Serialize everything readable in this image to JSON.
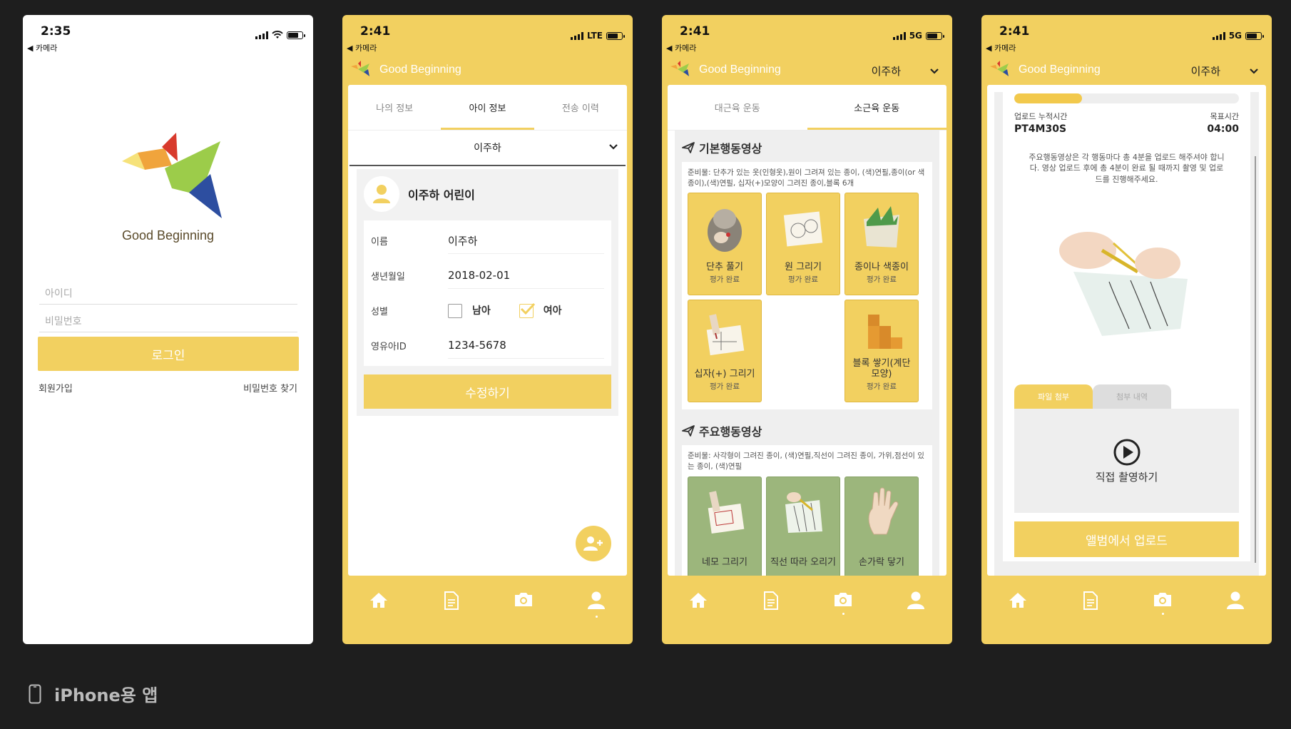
{
  "colors": {
    "accent": "#f2d060",
    "background": "#1e1e1e",
    "white": "#ffffff"
  },
  "status": {
    "back_label": "◀ 카메라",
    "p1_time": "2:35",
    "p2_time": "2:41",
    "p2_net": "LTE",
    "p3_time": "2:41",
    "p3_net": "5G",
    "p4_time": "2:41",
    "p4_net": "5G"
  },
  "brand": "Good Beginning",
  "login": {
    "id_placeholder": "아이디",
    "pw_placeholder": "비밀번호",
    "login_label": "로그인",
    "signup_label": "회원가입",
    "find_pw_label": "비밀번호 찾기"
  },
  "child_selector": "이주하",
  "profile": {
    "tabs": [
      "나의 정보",
      "아이 정보",
      "전송 이력"
    ],
    "active_tab": "아이 정보",
    "dropdown_value": "이주하",
    "card_title": "이주하 어린이",
    "fields": [
      {
        "label": "이름",
        "value": "이주하"
      },
      {
        "label": "생년월일",
        "value": "2018-02-01"
      },
      {
        "label": "성별",
        "value": ""
      },
      {
        "label": "영유아ID",
        "value": "1234-5678"
      }
    ],
    "gender_male": "남아",
    "gender_female": "여아",
    "gender_selected": "여아",
    "edit_label": "수정하기"
  },
  "motor": {
    "tabs": [
      "대근육 운동",
      "소근육 운동"
    ],
    "active_tab": "소근육 운동",
    "basic_title": "기본행동영상",
    "basic_prep": "준비물: 단추가 있는 옷(인형옷),원이 그려져 있는 종이, (색)연필,종이(or 색종이),(색)연필, 십자(+)모양이 그려진 종이,블록 6개",
    "basic_items": [
      {
        "name": "단추 풀기",
        "status": "평가 완료"
      },
      {
        "name": "원 그리기",
        "status": "평가 완료"
      },
      {
        "name": "종이나 색종이",
        "status": "평가 완료"
      },
      {
        "name": "십자(+) 그리기",
        "status": "평가 완료"
      },
      {
        "name": "블록 쌓기(계단 모양)",
        "status": "평가 완료"
      }
    ],
    "main_title": "주요행동영상",
    "main_prep": "준비물: 사각형이 그려진 종이, (색)연필,직선이 그려진 종이, 가위,점선이 있는 종이, (색)연필",
    "main_items": [
      {
        "name": "네모 그리기"
      },
      {
        "name": "직선 따라 오리기"
      },
      {
        "name": "손가락 닿기"
      }
    ]
  },
  "upload": {
    "progress_fraction": 0.3,
    "cumulative_label": "업로드 누적시간",
    "cumulative_value": "PT4M30S",
    "target_label": "목표시간",
    "target_value": "04:00",
    "notice": "주요행동영상은 각 행동마다 총 4분을 업로드 해주셔야 합니다. 영상 업로드 후에 총 4분이 완료 될 때까지 촬영 및 업로드를 진행해주세요.",
    "tab_attach": "파일 첨부",
    "tab_history": "첨부 내역",
    "shoot_label": "직접 촬영하기",
    "album_label": "앨범에서 업로드"
  },
  "nav": [
    "home-icon",
    "document-icon",
    "camera-icon",
    "person-icon"
  ],
  "caption": "iPhone용 앱"
}
